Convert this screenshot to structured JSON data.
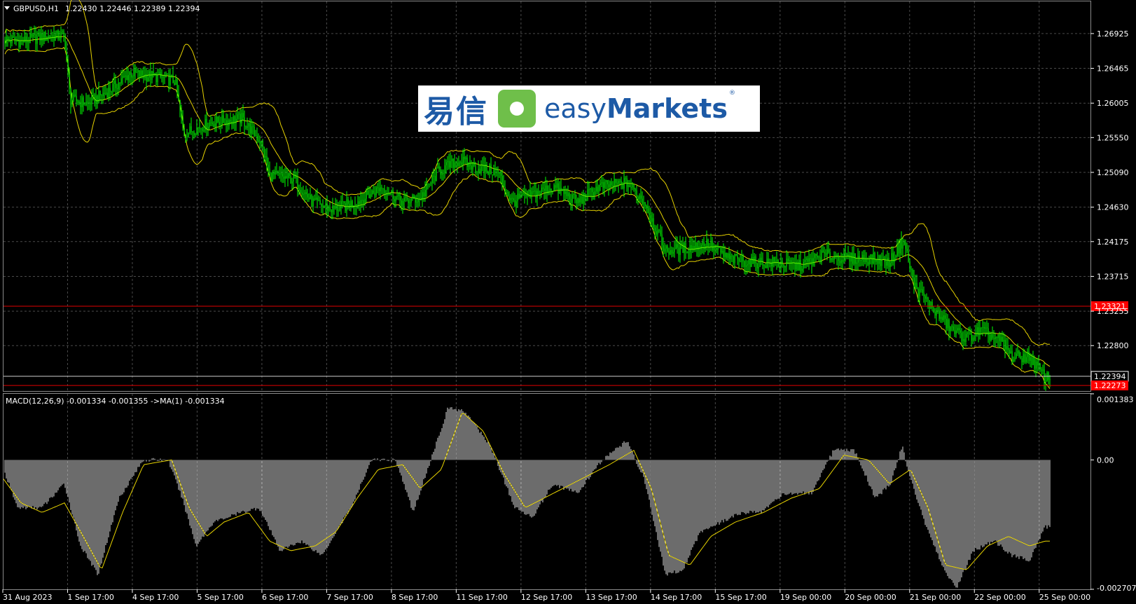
{
  "header": {
    "symbol": "GBPUSD,H1",
    "ohlc": "1.22430 1.22446 1.22389 1.22394"
  },
  "indicator_label": "MACD(12,26,9) -0.001334 -0.001355  ->MA(1) -0.001334",
  "logo": {
    "cn": "易信",
    "en_a": "easy",
    "en_b": "Markets",
    "reg": "®"
  },
  "colors": {
    "background": "#000000",
    "grid": "#4a4a4a",
    "candles": "#00ff00",
    "bands": "#e6d200",
    "level_line": "#e00000",
    "level_label_bg": "#ff0000",
    "macd_hist": "#d8d8d8",
    "macd_signal": "#e6d200"
  },
  "chart_data": [
    {
      "type": "candlestick",
      "title": "GBPUSD,H1",
      "indicator": "Bollinger Bands",
      "ylim": [
        1.222,
        1.2735
      ],
      "y_ticks": [
        "1.26925",
        "1.26465",
        "1.26005",
        "1.25550",
        "1.25090",
        "1.24630",
        "1.24175",
        "1.23715",
        "1.23255",
        "1.22800"
      ],
      "x_ticks": [
        "31 Aug 2023",
        "1 Sep 17:00",
        "4 Sep 17:00",
        "5 Sep 17:00",
        "6 Sep 17:00",
        "7 Sep 17:00",
        "8 Sep 17:00",
        "11 Sep 17:00",
        "12 Sep 17:00",
        "13 Sep 17:00",
        "14 Sep 17:00",
        "15 Sep 17:00",
        "19 Sep 00:00",
        "20 Sep 00:00",
        "21 Sep 00:00",
        "22 Sep 00:00",
        "25 Sep 00:00"
      ],
      "price_path": [
        [
          0,
          1.2685
        ],
        [
          30,
          1.2682
        ],
        [
          60,
          1.2688
        ],
        [
          92,
          1.269
        ],
        [
          100,
          1.2605
        ],
        [
          125,
          1.26
        ],
        [
          160,
          1.262
        ],
        [
          185,
          1.264
        ],
        [
          225,
          1.2635
        ],
        [
          250,
          1.263
        ],
        [
          262,
          1.256
        ],
        [
          300,
          1.2575
        ],
        [
          345,
          1.258
        ],
        [
          372,
          1.255
        ],
        [
          385,
          1.2505
        ],
        [
          420,
          1.25
        ],
        [
          445,
          1.247
        ],
        [
          475,
          1.246
        ],
        [
          510,
          1.247
        ],
        [
          545,
          1.249
        ],
        [
          575,
          1.247
        ],
        [
          600,
          1.2475
        ],
        [
          625,
          1.251
        ],
        [
          655,
          1.2525
        ],
        [
          680,
          1.2515
        ],
        [
          710,
          1.251
        ],
        [
          730,
          1.247
        ],
        [
          760,
          1.248
        ],
        [
          790,
          1.249
        ],
        [
          825,
          1.247
        ],
        [
          855,
          1.249
        ],
        [
          895,
          1.2495
        ],
        [
          920,
          1.247
        ],
        [
          950,
          1.2405
        ],
        [
          985,
          1.241
        ],
        [
          1010,
          1.2415
        ],
        [
          1040,
          1.2395
        ],
        [
          1075,
          1.239
        ],
        [
          1105,
          1.239
        ],
        [
          1140,
          1.2385
        ],
        [
          1175,
          1.24
        ],
        [
          1210,
          1.2395
        ],
        [
          1245,
          1.2395
        ],
        [
          1270,
          1.239
        ],
        [
          1290,
          1.242
        ],
        [
          1305,
          1.236
        ],
        [
          1340,
          1.232
        ],
        [
          1360,
          1.23
        ],
        [
          1380,
          1.229
        ],
        [
          1400,
          1.23
        ],
        [
          1430,
          1.2285
        ],
        [
          1445,
          1.2265
        ],
        [
          1470,
          1.2265
        ],
        [
          1492,
          1.2238
        ]
      ],
      "levels": [
        {
          "value": 1.23321,
          "label": "1.23321",
          "color": "red"
        },
        {
          "value": 1.22394,
          "label": "1.22394",
          "color": "white"
        },
        {
          "value": 1.22273,
          "label": "1.22273",
          "color": "red"
        }
      ]
    },
    {
      "type": "bar",
      "title": "MACD(12,26,9)",
      "ylim": [
        -0.002707,
        0.001383
      ],
      "y_ticks": [
        "0.001383",
        "0.00",
        "-0.002707"
      ],
      "macd_path": [
        [
          0,
          0.0
        ],
        [
          25,
          -0.001
        ],
        [
          60,
          -0.001
        ],
        [
          92,
          -0.0005
        ],
        [
          115,
          -0.0018
        ],
        [
          140,
          -0.0024
        ],
        [
          170,
          -0.0008
        ],
        [
          205,
          0.0
        ],
        [
          240,
          0.0
        ],
        [
          260,
          -0.0008
        ],
        [
          280,
          -0.0018
        ],
        [
          305,
          -0.0013
        ],
        [
          345,
          -0.0011
        ],
        [
          370,
          -0.001
        ],
        [
          400,
          -0.0019
        ],
        [
          430,
          -0.0017
        ],
        [
          460,
          -0.002
        ],
        [
          480,
          -0.0015
        ],
        [
          505,
          -0.0009
        ],
        [
          530,
          0.0
        ],
        [
          565,
          0.0
        ],
        [
          590,
          -0.0011
        ],
        [
          615,
          0.0
        ],
        [
          640,
          0.0011
        ],
        [
          665,
          0.001
        ],
        [
          700,
          0.0003
        ],
        [
          735,
          -0.001
        ],
        [
          760,
          -0.0012
        ],
        [
          790,
          -0.0005
        ],
        [
          825,
          -0.0007
        ],
        [
          860,
          0.0
        ],
        [
          895,
          0.0004
        ],
        [
          920,
          -0.0004
        ],
        [
          950,
          -0.0024
        ],
        [
          975,
          -0.0023
        ],
        [
          1000,
          -0.0015
        ],
        [
          1030,
          -0.0013
        ],
        [
          1060,
          -0.0011
        ],
        [
          1085,
          -0.0011
        ],
        [
          1120,
          -0.0007
        ],
        [
          1160,
          -0.0007
        ],
        [
          1190,
          0.0002
        ],
        [
          1220,
          0.0002
        ],
        [
          1250,
          -0.0008
        ],
        [
          1272,
          -0.0005
        ],
        [
          1288,
          0.0003
        ],
        [
          1300,
          -0.0004
        ],
        [
          1325,
          -0.0015
        ],
        [
          1345,
          -0.0022
        ],
        [
          1365,
          -0.0027
        ],
        [
          1390,
          -0.0019
        ],
        [
          1420,
          -0.0017
        ],
        [
          1445,
          -0.002
        ],
        [
          1470,
          -0.0021
        ],
        [
          1492,
          -0.0014
        ]
      ],
      "signal_path": [
        [
          0,
          -0.0003
        ],
        [
          30,
          -0.0009
        ],
        [
          60,
          -0.0011
        ],
        [
          92,
          -0.0009
        ],
        [
          115,
          -0.0015
        ],
        [
          145,
          -0.0023
        ],
        [
          175,
          -0.0011
        ],
        [
          205,
          -0.0001
        ],
        [
          245,
          0.0
        ],
        [
          270,
          -0.001
        ],
        [
          295,
          -0.0016
        ],
        [
          320,
          -0.0013
        ],
        [
          355,
          -0.0011
        ],
        [
          385,
          -0.0017
        ],
        [
          415,
          -0.0019
        ],
        [
          450,
          -0.0018
        ],
        [
          480,
          -0.0015
        ],
        [
          510,
          -0.0008
        ],
        [
          540,
          -0.0002
        ],
        [
          575,
          -0.0001
        ],
        [
          600,
          -0.0006
        ],
        [
          630,
          -0.0002
        ],
        [
          660,
          0.001
        ],
        [
          690,
          0.0006
        ],
        [
          720,
          -0.0003
        ],
        [
          750,
          -0.001
        ],
        [
          790,
          -0.0007
        ],
        [
          830,
          -0.0004
        ],
        [
          870,
          -0.0001
        ],
        [
          905,
          0.0002
        ],
        [
          930,
          -0.0006
        ],
        [
          955,
          -0.002
        ],
        [
          985,
          -0.0022
        ],
        [
          1015,
          -0.0016
        ],
        [
          1050,
          -0.0013
        ],
        [
          1090,
          -0.0011
        ],
        [
          1130,
          -0.0008
        ],
        [
          1170,
          -0.0006
        ],
        [
          1205,
          0.0001
        ],
        [
          1240,
          0.0
        ],
        [
          1270,
          -0.0005
        ],
        [
          1300,
          -0.0002
        ],
        [
          1325,
          -0.001
        ],
        [
          1350,
          -0.0022
        ],
        [
          1380,
          -0.0023
        ],
        [
          1410,
          -0.0018
        ],
        [
          1440,
          -0.0016
        ],
        [
          1470,
          -0.0018
        ],
        [
          1492,
          -0.0017
        ]
      ]
    }
  ]
}
